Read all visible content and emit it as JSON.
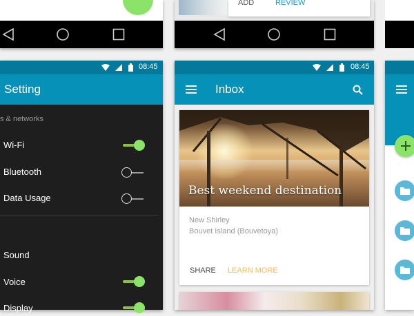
{
  "top_middle_actions": {
    "add": "ADD",
    "review": "REVIEW"
  },
  "settings_screen": {
    "status_time": "08:45",
    "title": "Setting",
    "section_header": "s & networks",
    "items": [
      {
        "label": "Wi-Fi",
        "on": true
      },
      {
        "label": "Bluetooth",
        "on": false
      },
      {
        "label": "Data Usage",
        "on": false
      },
      {
        "label": "Sound",
        "on": null
      },
      {
        "label": "Voice",
        "on": true
      },
      {
        "label": "Display",
        "on": true
      }
    ]
  },
  "inbox_screen": {
    "status_time": "08:45",
    "title": "Inbox",
    "card": {
      "image_title": "Best weekend destination",
      "line1": "New Shirley",
      "line2": "Bouvet Island (Bouvetoya)",
      "share_label": "SHARE",
      "learn_more_label": "LEARN MORE"
    }
  },
  "colors": {
    "primary": "#0691b9",
    "status_bar": "#05799b",
    "accent": "#f5bd4f",
    "switch_on": "#8be36a"
  }
}
